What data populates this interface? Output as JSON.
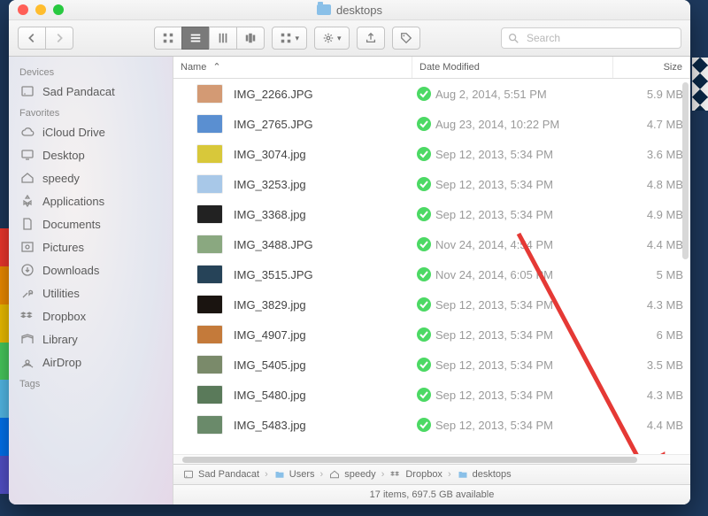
{
  "window": {
    "title": "desktops"
  },
  "toolbar": {
    "search_placeholder": "Search"
  },
  "sidebar": {
    "devices_title": "Devices",
    "devices": [
      {
        "label": "Sad Pandacat",
        "icon": "hdd"
      }
    ],
    "favorites_title": "Favorites",
    "favorites": [
      {
        "label": "iCloud Drive",
        "icon": "cloud"
      },
      {
        "label": "Desktop",
        "icon": "desktop"
      },
      {
        "label": "speedy",
        "icon": "home"
      },
      {
        "label": "Applications",
        "icon": "apps"
      },
      {
        "label": "Documents",
        "icon": "doc"
      },
      {
        "label": "Pictures",
        "icon": "pictures"
      },
      {
        "label": "Downloads",
        "icon": "downloads"
      },
      {
        "label": "Utilities",
        "icon": "utilities"
      },
      {
        "label": "Dropbox",
        "icon": "dropbox"
      },
      {
        "label": "Library",
        "icon": "library"
      },
      {
        "label": "AirDrop",
        "icon": "airdrop"
      }
    ],
    "tags_title": "Tags"
  },
  "columns": {
    "name": "Name",
    "modified": "Date Modified",
    "size": "Size"
  },
  "files": [
    {
      "name": "IMG_2266.JPG",
      "modified": "Aug 2, 2014, 5:51 PM",
      "size": "5.9 MB",
      "thumb": "#d39a74"
    },
    {
      "name": "IMG_2765.JPG",
      "modified": "Aug 23, 2014, 10:22 PM",
      "size": "4.7 MB",
      "thumb": "#5a8fd1"
    },
    {
      "name": "IMG_3074.jpg",
      "modified": "Sep 12, 2013, 5:34 PM",
      "size": "3.6 MB",
      "thumb": "#d8c83a"
    },
    {
      "name": "IMG_3253.jpg",
      "modified": "Sep 12, 2013, 5:34 PM",
      "size": "4.8 MB",
      "thumb": "#a8c8e8"
    },
    {
      "name": "IMG_3368.jpg",
      "modified": "Sep 12, 2013, 5:34 PM",
      "size": "4.9 MB",
      "thumb": "#222222"
    },
    {
      "name": "IMG_3488.JPG",
      "modified": "Nov 24, 2014, 4:54 PM",
      "size": "4.4 MB",
      "thumb": "#8aa880"
    },
    {
      "name": "IMG_3515.JPG",
      "modified": "Nov 24, 2014, 6:05 PM",
      "size": "5 MB",
      "thumb": "#264358"
    },
    {
      "name": "IMG_3829.jpg",
      "modified": "Sep 12, 2013, 5:34 PM",
      "size": "4.3 MB",
      "thumb": "#1a1410"
    },
    {
      "name": "IMG_4907.jpg",
      "modified": "Sep 12, 2013, 5:34 PM",
      "size": "6 MB",
      "thumb": "#c47a3a"
    },
    {
      "name": "IMG_5405.jpg",
      "modified": "Sep 12, 2013, 5:34 PM",
      "size": "3.5 MB",
      "thumb": "#7a8a6a"
    },
    {
      "name": "IMG_5480.jpg",
      "modified": "Sep 12, 2013, 5:34 PM",
      "size": "4.3 MB",
      "thumb": "#5a7a5a"
    },
    {
      "name": "IMG_5483.jpg",
      "modified": "Sep 12, 2013, 5:34 PM",
      "size": "4.4 MB",
      "thumb": "#6a8a6a"
    }
  ],
  "pathbar": [
    {
      "label": "Sad Pandacat",
      "icon": "hdd"
    },
    {
      "label": "Users",
      "icon": "folder"
    },
    {
      "label": "speedy",
      "icon": "home"
    },
    {
      "label": "Dropbox",
      "icon": "dropbox"
    },
    {
      "label": "desktops",
      "icon": "folder"
    }
  ],
  "status": "17 items, 697.5 GB available"
}
